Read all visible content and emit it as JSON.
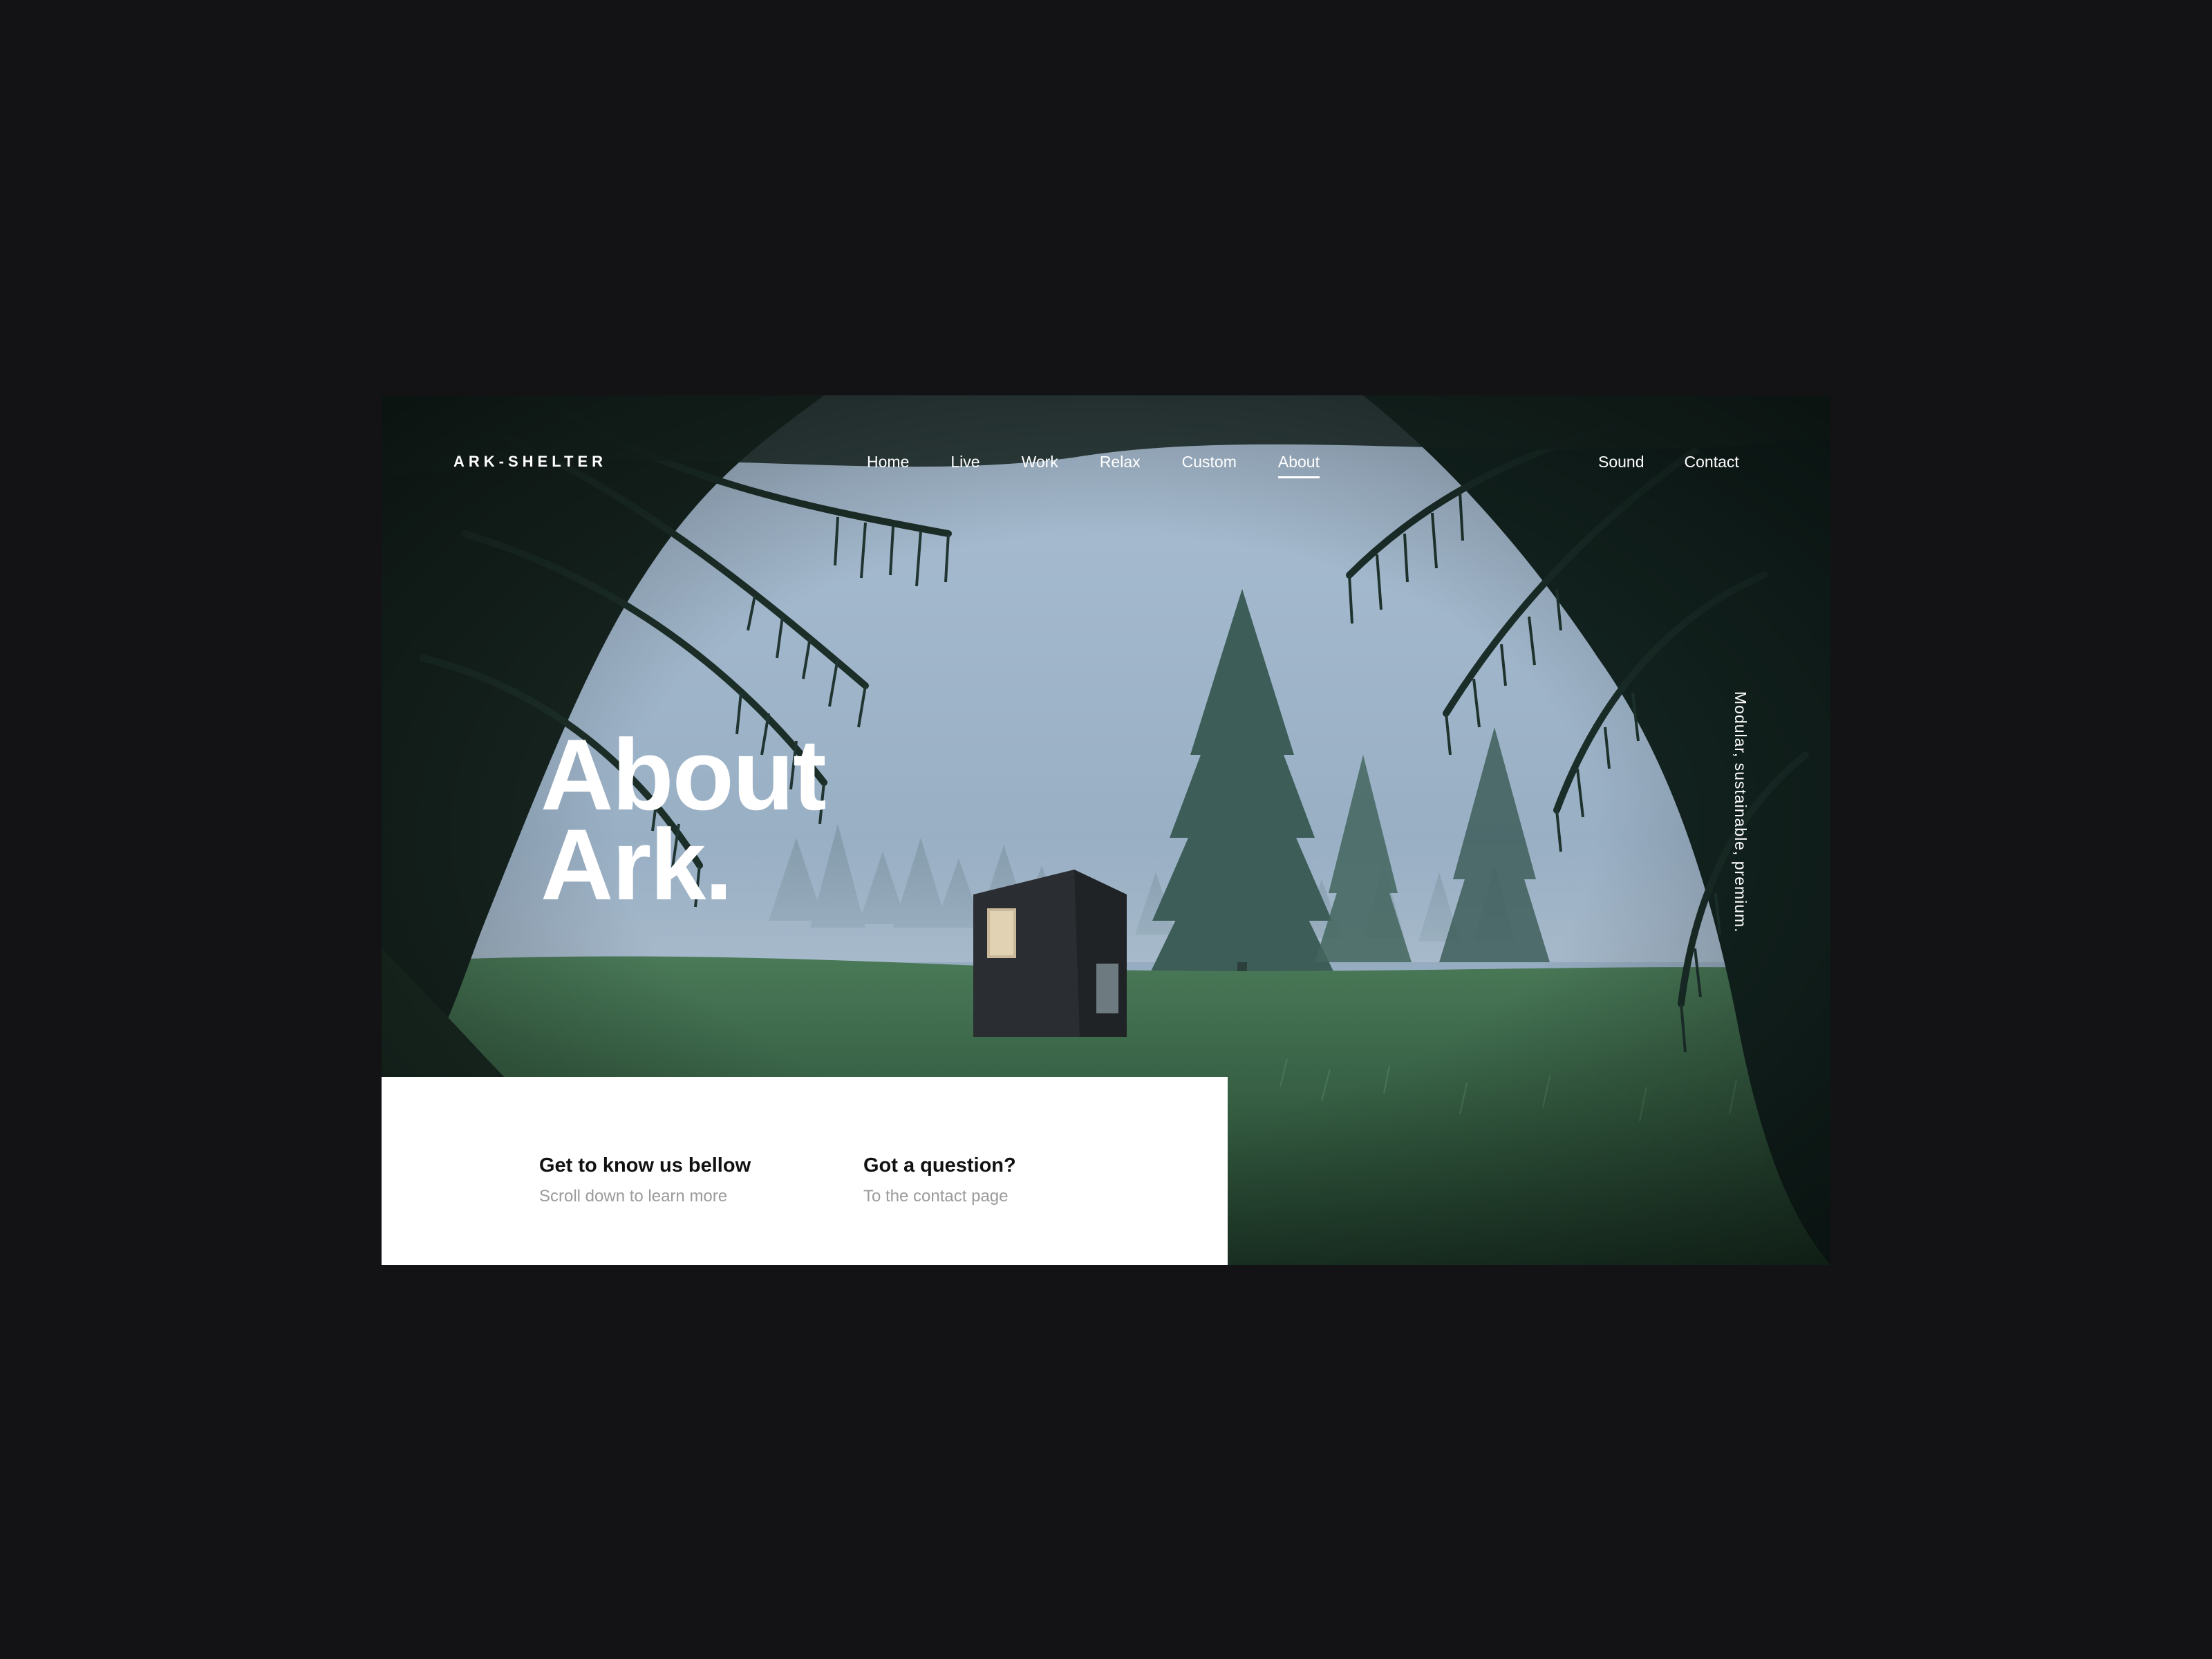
{
  "header": {
    "logo": "ARK-SHELTER",
    "nav": [
      {
        "label": "Home",
        "active": false
      },
      {
        "label": "Live",
        "active": false
      },
      {
        "label": "Work",
        "active": false
      },
      {
        "label": "Relax",
        "active": false
      },
      {
        "label": "Custom",
        "active": false
      },
      {
        "label": "About",
        "active": true
      }
    ],
    "nav_right": [
      {
        "label": "Sound"
      },
      {
        "label": "Contact"
      }
    ]
  },
  "hero": {
    "title_line1": "About",
    "title_line2": "Ark.",
    "tagline": "Modular, sustainable, premium."
  },
  "card": {
    "items": [
      {
        "title": "Get to know us bellow",
        "subtitle": "Scroll down to learn more"
      },
      {
        "title": "Got a question?",
        "subtitle": "To the contact page"
      }
    ]
  },
  "colors": {
    "page_background": "#131315",
    "sky": "#9fb6cc",
    "grass": "#3f6a4c",
    "foliage": "#1d2e2a",
    "card_background": "#ffffff",
    "card_title": "#111111",
    "card_subtitle": "#9b9b9b",
    "nav_text": "#ffffff"
  }
}
